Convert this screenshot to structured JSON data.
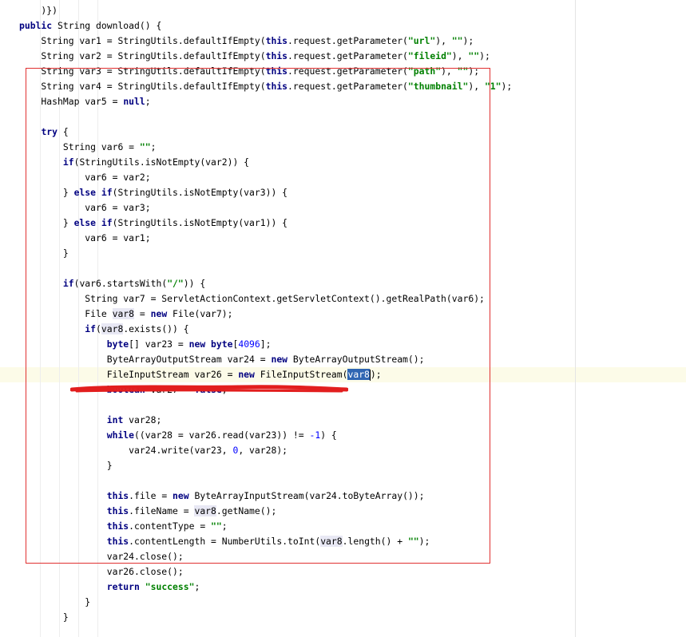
{
  "editor": {
    "lines": [
      [
        {
          "t": "    )})"
        }
      ],
      [
        {
          "t": "public",
          "c": "kw"
        },
        {
          "t": " String download() {"
        }
      ],
      [
        {
          "t": "    String var1 = StringUtils.defaultIfEmpty("
        },
        {
          "t": "this",
          "c": "kw"
        },
        {
          "t": ".request.getParameter("
        },
        {
          "t": "\"url\"",
          "c": "str"
        },
        {
          "t": "), "
        },
        {
          "t": "\"\"",
          "c": "str"
        },
        {
          "t": ");"
        }
      ],
      [
        {
          "t": "    String var2 = StringUtils.defaultIfEmpty("
        },
        {
          "t": "this",
          "c": "kw"
        },
        {
          "t": ".request.getParameter("
        },
        {
          "t": "\"fileid\"",
          "c": "str"
        },
        {
          "t": "), "
        },
        {
          "t": "\"\"",
          "c": "str"
        },
        {
          "t": ");"
        }
      ],
      [
        {
          "t": "    String var3 = StringUtils.defaultIfEmpty("
        },
        {
          "t": "this",
          "c": "kw"
        },
        {
          "t": ".request.getParameter("
        },
        {
          "t": "\"path\"",
          "c": "str"
        },
        {
          "t": "), "
        },
        {
          "t": "\"\"",
          "c": "str"
        },
        {
          "t": ");"
        }
      ],
      [
        {
          "t": "    String var4 = StringUtils.defaultIfEmpty("
        },
        {
          "t": "this",
          "c": "kw"
        },
        {
          "t": ".request.getParameter("
        },
        {
          "t": "\"thumbnail\"",
          "c": "str"
        },
        {
          "t": "), "
        },
        {
          "t": "\"1\"",
          "c": "str"
        },
        {
          "t": ");"
        }
      ],
      [
        {
          "t": "    HashMap var5 = "
        },
        {
          "t": "null",
          "c": "kw"
        },
        {
          "t": ";"
        }
      ],
      [],
      [
        {
          "t": "    "
        },
        {
          "t": "try",
          "c": "kw"
        },
        {
          "t": " {"
        }
      ],
      [
        {
          "t": "        String var6 = "
        },
        {
          "t": "\"\"",
          "c": "str"
        },
        {
          "t": ";"
        }
      ],
      [
        {
          "t": "        "
        },
        {
          "t": "if",
          "c": "kw"
        },
        {
          "t": "(StringUtils.isNotEmpty(var2)) {"
        }
      ],
      [
        {
          "t": "            var6 = var2;"
        }
      ],
      [
        {
          "t": "        } "
        },
        {
          "t": "else if",
          "c": "kw"
        },
        {
          "t": "(StringUtils.isNotEmpty(var3)) {"
        }
      ],
      [
        {
          "t": "            var6 = var3;"
        }
      ],
      [
        {
          "t": "        } "
        },
        {
          "t": "else if",
          "c": "kw"
        },
        {
          "t": "(StringUtils.isNotEmpty(var1)) {"
        }
      ],
      [
        {
          "t": "            var6 = var1;"
        }
      ],
      [
        {
          "t": "        }"
        }
      ],
      [],
      [
        {
          "t": "        "
        },
        {
          "t": "if",
          "c": "kw"
        },
        {
          "t": "(var6.startsWith("
        },
        {
          "t": "\"/\"",
          "c": "str"
        },
        {
          "t": ")) {"
        }
      ],
      [
        {
          "t": "            String var7 = ServletActionContext.getServletContext().getRealPath(var6);"
        }
      ],
      [
        {
          "t": "            File "
        },
        {
          "t": "var8",
          "c": "ref"
        },
        {
          "t": " = "
        },
        {
          "t": "new",
          "c": "kw"
        },
        {
          "t": " File(var7);"
        }
      ],
      [
        {
          "t": "            "
        },
        {
          "t": "if",
          "c": "kw"
        },
        {
          "t": "("
        },
        {
          "t": "var8",
          "c": "ref"
        },
        {
          "t": ".exists()) {"
        }
      ],
      [
        {
          "t": "                "
        },
        {
          "t": "byte",
          "c": "kw"
        },
        {
          "t": "[] var23 = "
        },
        {
          "t": "new",
          "c": "kw"
        },
        {
          "t": " "
        },
        {
          "t": "byte",
          "c": "kw"
        },
        {
          "t": "["
        },
        {
          "t": "4096",
          "c": "num"
        },
        {
          "t": "];"
        }
      ],
      [
        {
          "t": "                ByteArrayOutputStream var24 = "
        },
        {
          "t": "new",
          "c": "kw"
        },
        {
          "t": " ByteArrayOutputStream();"
        }
      ],
      [
        {
          "t": "                FileInputStream var26 = "
        },
        {
          "t": "new",
          "c": "kw"
        },
        {
          "t": " FileInputStream("
        },
        {
          "t": "var8",
          "c": "sel"
        },
        {
          "t": "|",
          "c": "caret"
        },
        {
          "t": ");"
        }
      ],
      [
        {
          "t": "                "
        },
        {
          "t": "boolean",
          "c": "kw"
        },
        {
          "t": " var27 = "
        },
        {
          "t": "false",
          "c": "kw"
        },
        {
          "t": ";"
        }
      ],
      [],
      [
        {
          "t": "                "
        },
        {
          "t": "int",
          "c": "kw"
        },
        {
          "t": " var28;"
        }
      ],
      [
        {
          "t": "                "
        },
        {
          "t": "while",
          "c": "kw"
        },
        {
          "t": "((var28 = var26.read(var23)) != "
        },
        {
          "t": "-1",
          "c": "num"
        },
        {
          "t": ") {"
        }
      ],
      [
        {
          "t": "                    var24.write(var23, "
        },
        {
          "t": "0",
          "c": "num"
        },
        {
          "t": ", var28);"
        }
      ],
      [
        {
          "t": "                }"
        }
      ],
      [],
      [
        {
          "t": "                "
        },
        {
          "t": "this",
          "c": "kw"
        },
        {
          "t": ".file = "
        },
        {
          "t": "new",
          "c": "kw"
        },
        {
          "t": " ByteArrayInputStream(var24.toByteArray());"
        }
      ],
      [
        {
          "t": "                "
        },
        {
          "t": "this",
          "c": "kw"
        },
        {
          "t": ".fileName = "
        },
        {
          "t": "var8",
          "c": "ref"
        },
        {
          "t": ".getName();"
        }
      ],
      [
        {
          "t": "                "
        },
        {
          "t": "this",
          "c": "kw"
        },
        {
          "t": ".contentType = "
        },
        {
          "t": "\"\"",
          "c": "str"
        },
        {
          "t": ";"
        }
      ],
      [
        {
          "t": "                "
        },
        {
          "t": "this",
          "c": "kw"
        },
        {
          "t": ".contentLength = NumberUtils.toInt("
        },
        {
          "t": "var8",
          "c": "ref"
        },
        {
          "t": ".length() + "
        },
        {
          "t": "\"\"",
          "c": "str"
        },
        {
          "t": ");"
        }
      ],
      [
        {
          "t": "                var24.close();"
        }
      ],
      [
        {
          "t": "                var26.close();"
        }
      ],
      [
        {
          "t": "                "
        },
        {
          "t": "return",
          "c": "kw"
        },
        {
          "t": " "
        },
        {
          "t": "\"success\"",
          "c": "str"
        },
        {
          "t": ";"
        }
      ],
      [
        {
          "t": "            }"
        }
      ],
      [
        {
          "t": "        }"
        }
      ]
    ]
  }
}
